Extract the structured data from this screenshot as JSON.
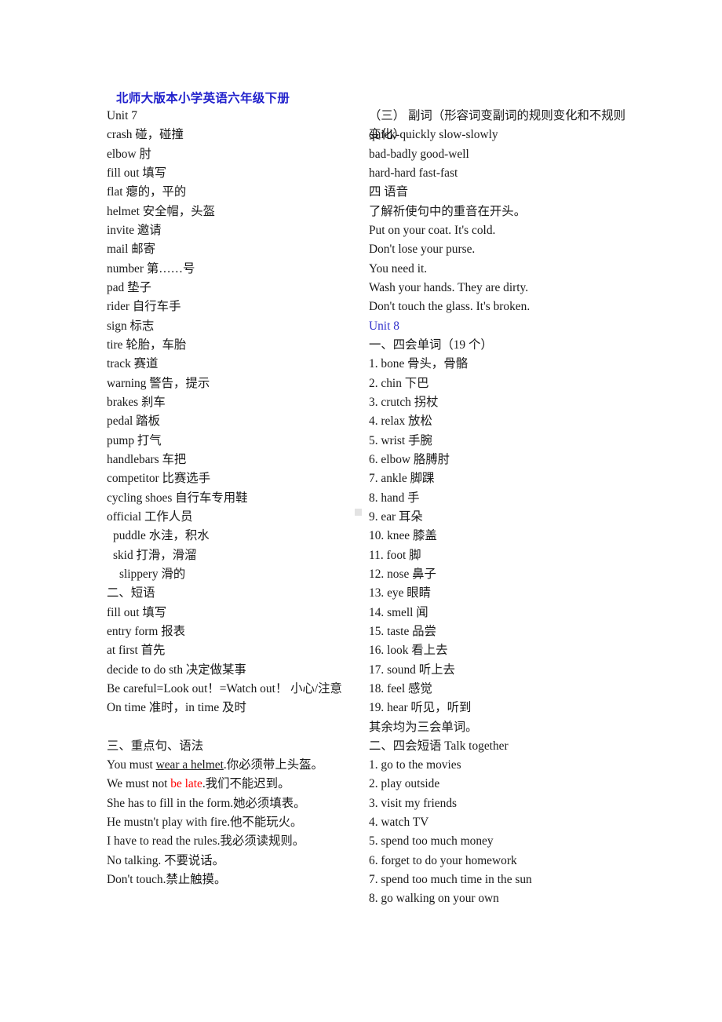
{
  "document": {
    "title": "北师大版本小学英语六年级下册",
    "title_color": "#2222CC",
    "accent_blue": "#3333CC",
    "accent_red": "#FF0000",
    "page_background": "#FFFFFF"
  },
  "left_column": {
    "lines": [
      "Unit 7",
      "crash  碰，碰撞",
      "elbow   肘",
      "fill out   填写",
      "flat 瘪的，平的",
      "helmet   安全帽，头盔",
      "invite   邀请",
      "mail   邮寄",
      "number   第……号",
      "pad   垫子",
      "rider   自行车手",
      "sign   标志",
      "tire   轮胎，车胎",
      "track   赛道",
      "warning  警告，提示",
      "brakes  刹车",
      "pedal  踏板",
      "pump  打气",
      "handlebars  车把",
      "competitor   比赛选手",
      "cycling shoes  自行车专用鞋",
      "official   工作人员",
      "puddle   水洼，积水",
      "skid   打滑，滑溜",
      "slippery   滑的",
      "二、短语",
      "fill out 填写",
      "entry form 报表",
      "at first  首先",
      "decide to do sth 决定做某事",
      "Be careful=Look out！=Watch out！ 小心/注意",
      "On time 准时，in time 及时",
      "",
      "三、重点句、语法"
    ],
    "grammar": {
      "s1_pre": "You must ",
      "s1_underline": "wear a helmet",
      "s1_post": ".你必须带上头盔。",
      "s2_pre": "We must not ",
      "s2_red": "be late",
      "s2_post": ".我们不能迟到。",
      "s3": "She has to fill in the form.她必须填表。",
      "s4": "He mustn't play with fire.他不能玩火。",
      "s5": "I have to read the rules.我必须读规则。",
      "s6": "No talking.  不要说话。",
      "s7": "Don't touch.禁止触摸。"
    }
  },
  "right_column": {
    "lines": [
      "（三） 副词（形容词变副词的规则变化和不规则变化）",
      "quick-quickly    slow-slowly",
      "bad-badly   good-well",
      "hard-hard   fast-fast",
      "四  语音",
      "了解祈使句中的重音在开头。",
      "Put on your coat. It's cold.",
      "Don't lose your purse.",
      "You need it.",
      "Wash your hands. They are dirty.",
      "Don't touch the glass. It's broken."
    ],
    "unit8_heading": "Unit 8",
    "section_one_heading": "一、四会单词（19  个）",
    "vocabulary": [
      "1. bone  骨头，骨骼",
      "2. chin  下巴",
      "3. crutch  拐杖",
      "4. relax  放松",
      "5. wrist  手腕",
      "6. elbow  胳膊肘",
      "7. ankle  脚踝",
      "8. hand  手",
      "9. ear  耳朵",
      "10. knee  膝盖",
      "11. foot  脚",
      "12. nose  鼻子",
      "13. eye  眼睛",
      "14. smell  闻",
      "15. taste  品尝",
      "16. look  看上去",
      "17. sound  听上去",
      "18. feel  感觉",
      "19. hear  听见，听到"
    ],
    "note": "其余均为三会单词。",
    "section_two_heading": "二、四会短语 Talk together",
    "phrases": [
      "1. go to the movies",
      "2. play outside",
      "3. visit my friends",
      "4. watch TV",
      "5. spend too much money",
      "6. forget to do your homework",
      "7. spend too much time in the sun",
      "8. go walking on your own"
    ]
  }
}
